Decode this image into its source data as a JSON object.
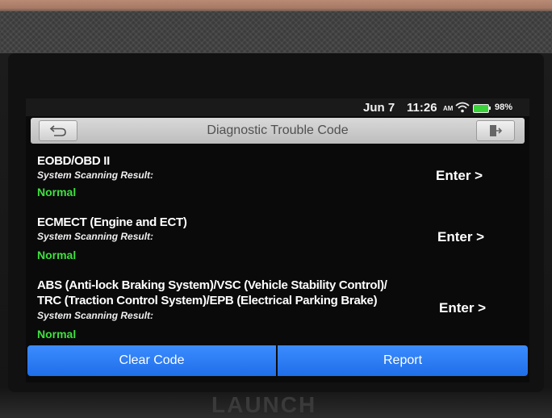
{
  "status": {
    "date": "Jun 7",
    "time": "11:26",
    "ampm": "AM",
    "battery": "98%"
  },
  "header": {
    "title": "Diagnostic Trouble Code",
    "back_icon": "back-arrow-icon",
    "exit_icon": "exit-icon"
  },
  "systems": [
    {
      "name": "EOBD/OBD II",
      "scan_label": "System Scanning Result:",
      "status": "Normal",
      "enter_label": "Enter >"
    },
    {
      "name": "ECMECT (Engine and ECT)",
      "scan_label": "System Scanning Result:",
      "status": "Normal",
      "enter_label": "Enter >"
    },
    {
      "name": "ABS (Anti-lock Braking System)/VSC (Vehicle Stability Control)/ TRC (Traction Control System)/EPB (Electrical Parking Brake)",
      "scan_label": "System Scanning Result:",
      "status": "Normal",
      "enter_label": "Enter >"
    }
  ],
  "footer": {
    "clear_label": "Clear Code",
    "report_label": "Report"
  },
  "device": {
    "brand": "LAUNCH"
  },
  "colors": {
    "accent_blue": "#2a7cf5",
    "status_normal": "#3fe03f"
  }
}
